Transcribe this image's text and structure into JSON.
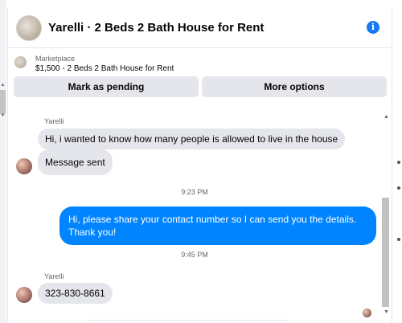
{
  "header": {
    "title": "Yarelli · 2 Beds 2 Bath House for Rent",
    "info_icon": "info-icon"
  },
  "listing": {
    "source": "Marketplace",
    "price_title": "$1,500 - 2 Beds 2 Bath House for Rent"
  },
  "actions": {
    "mark_pending": "Mark as pending",
    "more_options": "More options"
  },
  "messages": [
    {
      "sender": "Yarelli",
      "text": "Hi, i wanted to know how many people is allowed to live in the house"
    },
    {
      "text": "Message sent"
    },
    {
      "timestamp": "9:23 PM"
    },
    {
      "text": "Hi, please share your contact number so I can send you the details. Thank you!",
      "outgoing": true
    },
    {
      "timestamp": "9:45 PM"
    },
    {
      "sender": "Yarelli",
      "text": "323-830-8661"
    }
  ],
  "colors": {
    "accent": "#0084ff",
    "info": "#1877f2",
    "incoming_bubble": "#e4e6eb"
  }
}
